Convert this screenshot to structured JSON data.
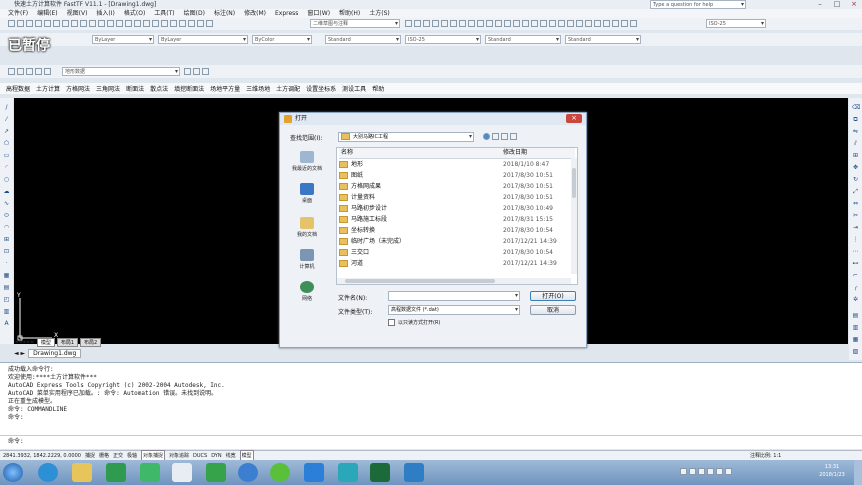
{
  "window": {
    "title": "快速土方计算软件 FastTF V11.1 - [Drawing1.dwg]",
    "help_placeholder": "Type a question for help"
  },
  "menu": [
    "文件(F)",
    "编辑(E)",
    "视图(V)",
    "插入(I)",
    "格式(O)",
    "工具(T)",
    "绘图(D)",
    "标注(N)",
    "修改(M)",
    "Express",
    "窗口(W)",
    "帮助(H)",
    "土方(S)"
  ],
  "toolbar": {
    "workspace": "二维草图与注释",
    "layer_color": "ByLayer",
    "linetype": "ByLayer",
    "color": "ByColor",
    "text_style": "Standard",
    "dim_style": "ISO-25",
    "table_style": "Standard",
    "multileader_style": "Standard",
    "layer_name": "地形数据"
  },
  "big_label": "已暂停",
  "layer_combo": "0",
  "quick_menu": [
    "高程数据",
    "土方计算",
    "方格网法",
    "三角网法",
    "断面法",
    "散点法",
    "填挖断面法",
    "场地平方量",
    "三维场地",
    "土方调配",
    "设置坐标系",
    "测设工具",
    "帮助"
  ],
  "drawing_tabs": [
    "模型",
    "布局1",
    "布局2"
  ],
  "file_tab": "Drawing1.dwg",
  "ucs": {
    "x": "X",
    "y": "Y"
  },
  "dialog": {
    "title": "打开",
    "lookin_label": "查找范围(I):",
    "lookin_value": "大别马路IC工程",
    "col_name": "名称",
    "col_date": "修改日期",
    "places": [
      "我最近的文档",
      "桌面",
      "我的文档",
      "计算机",
      "网络"
    ],
    "files": [
      {
        "name": "地形",
        "date": "2018/1/10 8:47"
      },
      {
        "name": "图纸",
        "date": "2017/8/30 10:51"
      },
      {
        "name": "方格网成果",
        "date": "2017/8/30 10:51"
      },
      {
        "name": "计量资料",
        "date": "2017/8/30 10:51"
      },
      {
        "name": "马路初步设计",
        "date": "2017/8/30 10:49"
      },
      {
        "name": "马路施工标段",
        "date": "2017/8/31 15:15"
      },
      {
        "name": "坐标转换",
        "date": "2017/8/30 10:54"
      },
      {
        "name": "临时广场（未完成）",
        "date": "2017/12/21 14:39"
      },
      {
        "name": "三交口",
        "date": "2017/8/30 10:54"
      },
      {
        "name": "河道",
        "date": "2017/12/21 14:39"
      }
    ],
    "filename_label": "文件名(N):",
    "filename_value": "",
    "filetype_label": "文件类型(T):",
    "filetype_value": "高程数据文件 (*.dat)",
    "readonly_label": "以只读方式打开(R)",
    "open_button": "打开(O)",
    "cancel_button": "取消"
  },
  "command_lines": [
    "成功载入命令行:",
    "欢迎使用:****土方计算软件***",
    "AutoCAD Express Tools Copyright (c) 2002-2004 Autodesk, Inc.",
    "AutoCAD 菜单实用程序已加载。: 命令: Automation 错误。未找到说明。",
    "正在重生成模型。",
    "命令: COMMANDLINE",
    "命令:"
  ],
  "command_prompt": "命令:",
  "status": {
    "coords": "2841.3932, 1842.2229, 0.0000",
    "toggles": [
      "捕捉",
      "栅格",
      "正交",
      "极轴",
      "对象捕捉",
      "对象追踪",
      "DUCS",
      "DYN",
      "线宽",
      "模型"
    ],
    "annotation_scale": "注释比例: 1:1"
  },
  "clock": {
    "time": "13:31",
    "date": "2018/1/23"
  }
}
